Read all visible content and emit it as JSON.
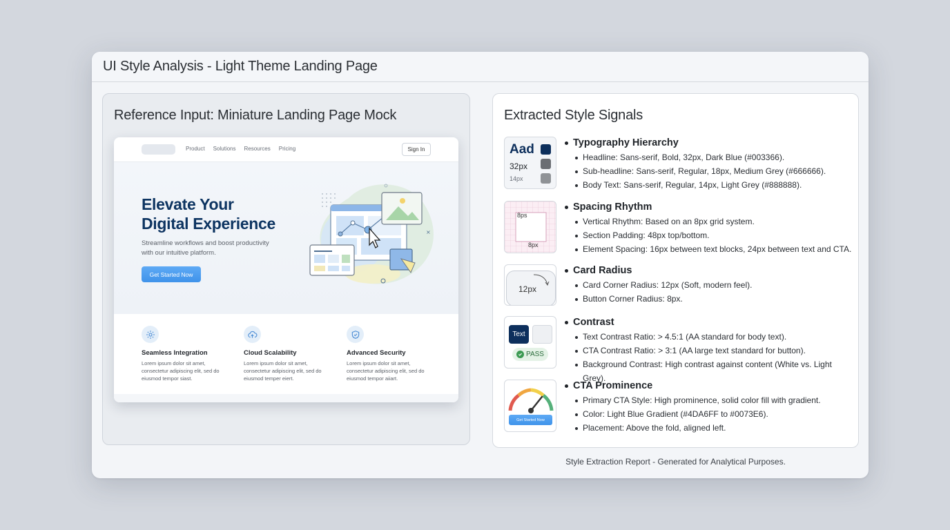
{
  "window": {
    "title": "UI Style Analysis - Light Theme Landing Page"
  },
  "left": {
    "heading": "Reference Input: Miniature Landing Page Mock",
    "mock": {
      "nav": {
        "links": [
          "Product",
          "Solutions",
          "Resources",
          "Pricing"
        ],
        "signin": "Sign In"
      },
      "hero": {
        "title_line1": "Elevate Your",
        "title_line2": "Digital Experience",
        "sub_line1": "Streamline workflows and boost productivity",
        "sub_line2": "with our intuitive platform.",
        "cta": "Get Started Now"
      },
      "features": [
        {
          "icon": "gear-icon",
          "title": "Seamless Integration",
          "body_line1": "Lorem ipsum dolor sit amet,",
          "body_line2": "consectetur adipiscing elit, sed do",
          "body_line3": "eiusmod tempor siast."
        },
        {
          "icon": "cloud-upload-icon",
          "title": "Cloud Scalability",
          "body_line1": "Lorem ipsum dolor sit amet,",
          "body_line2": "consectetur adipiscing elit, sed do",
          "body_line3": "eiusmod temper eiert."
        },
        {
          "icon": "shield-check-icon",
          "title": "Advanced Security",
          "body_line1": "Lorem ipsum dolor sit amet,",
          "body_line2": "consectetur adipiscing elit, sed do",
          "body_line3": "eiusmod tempor aiiart."
        }
      ]
    }
  },
  "right": {
    "heading": "Extracted Style Signals",
    "signals": [
      {
        "title": "Typography Hierarchy",
        "thumb": {
          "labels": [
            "Aad",
            "32px",
            "14px"
          ],
          "swatches": [
            "#0d2f5c",
            "#6b6e73",
            "#8f9296"
          ]
        },
        "items": [
          "Headline: Sans-serif, Bold, 32px, Dark Blue (#003366).",
          "Sub-headline: Sans-serif, Regular, 18px, Medium Grey (#666666).",
          "Body Text: Sans-serif, Regular, 14px, Light Grey (#888888)."
        ]
      },
      {
        "title": "Spacing Rhythm",
        "thumb": {
          "labels": [
            "8ps",
            "8px"
          ]
        },
        "items": [
          "Vertical Rhythm: Based on an 8px grid system.",
          "Section Padding: 48px top/bottom.",
          "Element Spacing: 16px between text blocks, 24px between text and CTA."
        ]
      },
      {
        "title": "Card Radius",
        "thumb": {
          "labels": [
            "12px"
          ]
        },
        "items": [
          "Card Corner Radius: 12px (Soft, modern feel).",
          "Button Corner Radius: 8px."
        ]
      },
      {
        "title": "Contrast",
        "thumb": {
          "labels": [
            "Text",
            "PASS"
          ]
        },
        "items": [
          "Text Contrast Ratio: > 4.5:1 (AA standard for body text).",
          "CTA Contrast Ratio: > 3:1 (AA large text standard for button).",
          "Background Contrast: High contrast against content (White vs. Light Grey)."
        ]
      },
      {
        "title": "CTA Prominence",
        "thumb": {
          "labels": [
            "Get Started Now"
          ]
        },
        "items": [
          "Primary CTA Style: High prominence, solid color fill with gradient.",
          "Color: Light Blue Gradient (#4DA6FF to #0073E6).",
          "Placement: Above the fold, aligned left."
        ]
      }
    ]
  },
  "footer": "Style Extraction Report - Generated for Analytical Purposes."
}
